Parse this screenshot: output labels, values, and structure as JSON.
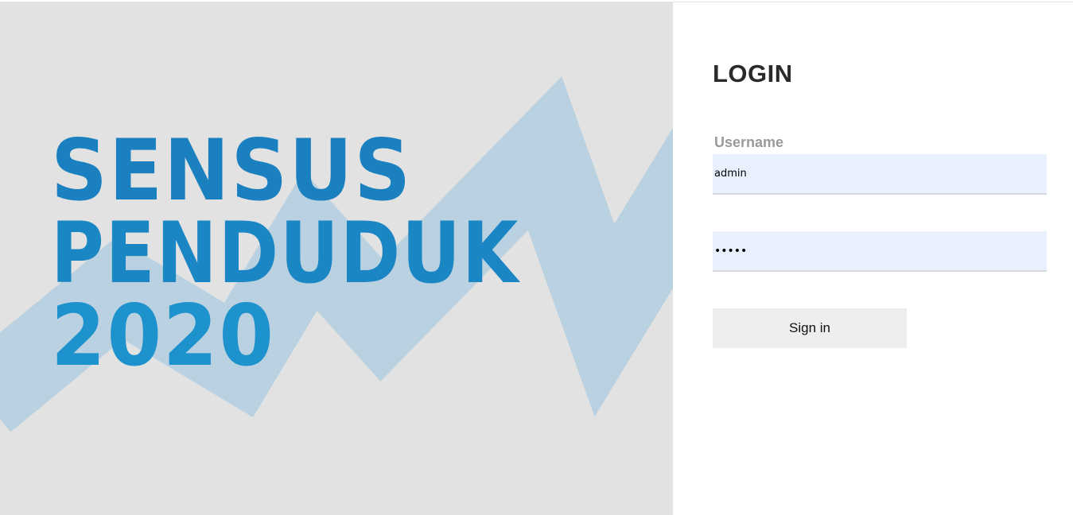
{
  "hero": {
    "lines": [
      "SENSUS",
      "PENDUDUK",
      "2020"
    ],
    "text_color": "#1b86c4",
    "background_color": "#e2e2e2"
  },
  "login": {
    "title": "LOGIN",
    "username_label": "Username",
    "username_value": "admin",
    "password_value": "•••••",
    "signin_label": "Sign in",
    "input_background": "#e8f0fe"
  }
}
